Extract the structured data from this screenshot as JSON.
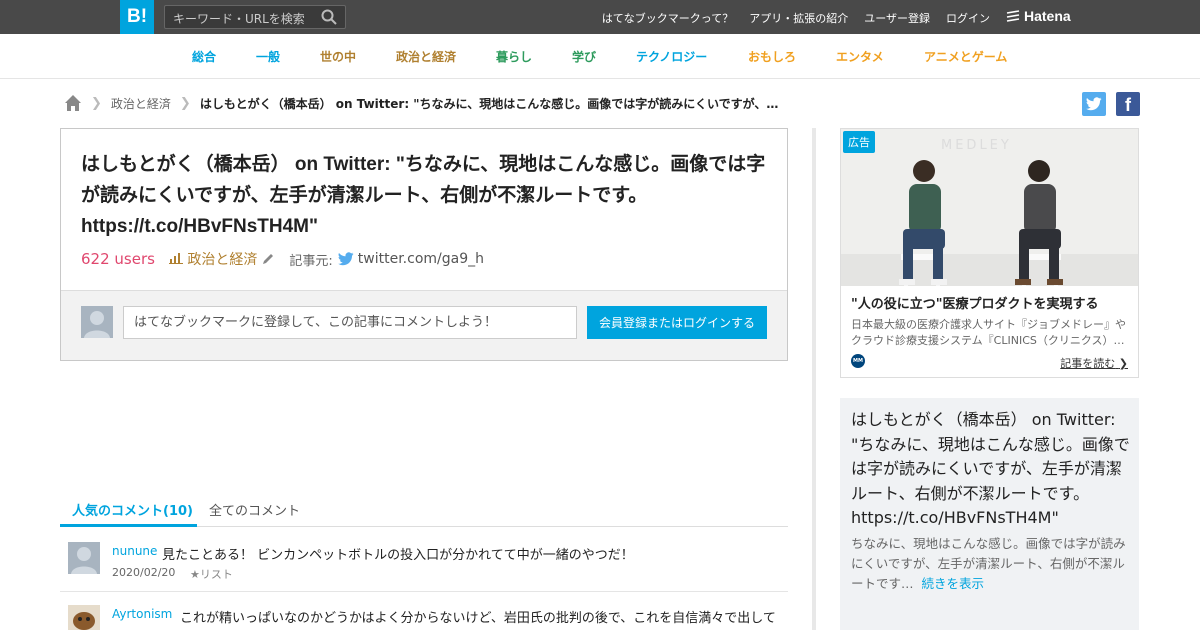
{
  "header": {
    "logo": "B!",
    "search_placeholder": "キーワード・URLを検索",
    "links": [
      "はてなブックマークって？",
      "アプリ・拡張の紹介",
      "ユーザー登録",
      "ログイン"
    ],
    "brand": "Hatena"
  },
  "categories": [
    {
      "label": "総合",
      "color": "#00a4de"
    },
    {
      "label": "一般",
      "color": "#00a4de"
    },
    {
      "label": "世の中",
      "color": "#b08030"
    },
    {
      "label": "政治と経済",
      "color": "#b08030"
    },
    {
      "label": "暮らし",
      "color": "#2e9b5d"
    },
    {
      "label": "学び",
      "color": "#2e9b5d"
    },
    {
      "label": "テクノロジー",
      "color": "#00a4de"
    },
    {
      "label": "おもしろ",
      "color": "#f0a020"
    },
    {
      "label": "エンタメ",
      "color": "#f0a020"
    },
    {
      "label": "アニメとゲーム",
      "color": "#f0a020"
    }
  ],
  "breadcrumb": {
    "category": "政治と経済",
    "title": "はしもとがく（橋本岳） on Twitter: \"ちなみに、現地はこんな感じ。画像では字が読みにくいですが、…"
  },
  "entry": {
    "title": "はしもとがく（橋本岳） on Twitter: \"ちなみに、現地はこんな感じ。画像では字が読みにくいですが、左手が清潔ルート、右側が不潔ルートです。 https://t.co/HBvFNsTH4M\"",
    "users": "622 users",
    "category": "政治と経済",
    "source_label": "記事元:",
    "source_domain": "twitter.com/ga9_h"
  },
  "comment_form": {
    "placeholder": "はてなブックマークに登録して、この記事にコメントしよう！",
    "button": "会員登録またはログインする"
  },
  "tabs": {
    "popular": "人気のコメント(10)",
    "all": "全てのコメント"
  },
  "comments": [
    {
      "user": "nunune",
      "text": "見たことある！ ビンカンペットボトルの投入口が分かれてて中が一緒のやつだ！",
      "date": "2020/02/20",
      "list": "★リスト"
    },
    {
      "user": "Ayrtonism",
      "text": "これが精いっぱいなのかどうかはよく分からないけど、岩田氏の批判の後で、これを自信満々で出して",
      "date": "",
      "list": ""
    }
  ],
  "ad": {
    "badge": "広告",
    "headline": "\"人の役に立つ\"医療プロダクトを実現する",
    "description": "日本最大級の医療介護求人サイト『ジョブメドレー』やクラウド診療支援システム『CLINICS（クリニクス）…",
    "more": "記事を読む"
  },
  "summary": {
    "title": "はしもとがく（橋本岳） on Twitter: \"ちなみに、現地はこんな感じ。画像では字が読みにくいですが、左手が清潔ルート、右側が不潔ルートです。 https://t.co/HBvFNsTH4M\"",
    "text": "ちなみに、現地はこんな感じ。画像では字が読みにくいですが、左手が清潔ルート、右側が不潔ルートです…",
    "more": "続きを表示"
  }
}
